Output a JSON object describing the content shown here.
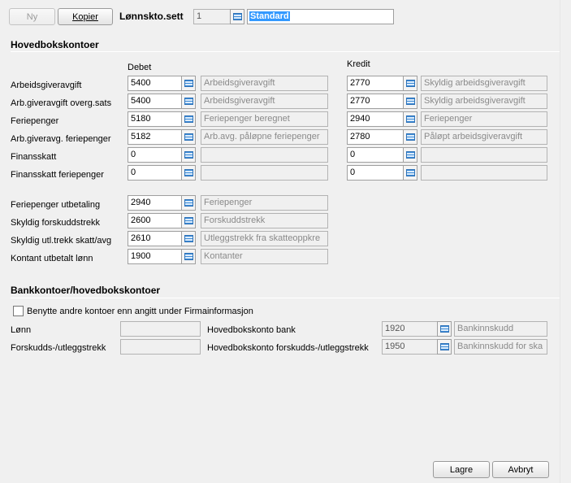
{
  "toolbar": {
    "new_label": "Ny",
    "copy_label": "Kopier",
    "set_label": "Lønnskto.sett",
    "set_number": "1",
    "set_name": "Standard"
  },
  "main_section": {
    "title": "Hovedbokskontoer",
    "debit_header": "Debet",
    "credit_header": "Kredit",
    "rows": [
      {
        "label": "Arbeidsgiveravgift",
        "debit": "5400",
        "debit_name": "Arbeidsgiveravgift",
        "credit": "2770",
        "credit_name": "Skyldig arbeidsgiveravgift"
      },
      {
        "label": "Arb.giveravgift overg.sats",
        "debit": "5400",
        "debit_name": "Arbeidsgiveravgift",
        "credit": "2770",
        "credit_name": "Skyldig arbeidsgiveravgift"
      },
      {
        "label": "Feriepenger",
        "debit": "5180",
        "debit_name": "Feriepenger beregnet",
        "credit": "2940",
        "credit_name": "Feriepenger"
      },
      {
        "label": "Arb.giveravg. feriepenger",
        "debit": "5182",
        "debit_name": "Arb.avg. påløpne feriepenger",
        "credit": "2780",
        "credit_name": "Påløpt arbeidsgiveravgift"
      },
      {
        "label": "Finansskatt",
        "debit": "0",
        "debit_name": "",
        "credit": "0",
        "credit_name": ""
      },
      {
        "label": "Finansskatt feriepenger",
        "debit": "0",
        "debit_name": "",
        "credit": "0",
        "credit_name": ""
      }
    ],
    "single_rows": [
      {
        "label": "Feriepenger utbetaling",
        "value": "2940",
        "name": "Feriepenger"
      },
      {
        "label": "Skyldig forskuddstrekk",
        "value": "2600",
        "name": "Forskuddstrekk"
      },
      {
        "label": "Skyldig utl.trekk skatt/avg",
        "value": "2610",
        "name": "Utleggstrekk fra skatteoppkre"
      },
      {
        "label": "Kontant utbetalt lønn",
        "value": "1900",
        "name": "Kontanter"
      }
    ]
  },
  "bank_section": {
    "title": "Bankkontoer/hovedbokskontoer",
    "checkbox_label": "Benytte andre kontoer enn angitt under Firmainformasjon",
    "checkbox_checked": false,
    "salary_label": "Lønn",
    "salary_value": "",
    "advance_label": "Forskudds-/utleggstrekk",
    "advance_value": "",
    "bank_account_label": "Hovedbokskonto bank",
    "bank_account_value": "1920",
    "bank_account_name": "Bankinnskudd",
    "advance_account_label": "Hovedbokskonto forskudds-/utleggstrekk",
    "advance_account_value": "1950",
    "advance_account_name": "Bankinnskudd for ska"
  },
  "footer": {
    "save_label": "Lagre",
    "cancel_label": "Avbryt"
  }
}
